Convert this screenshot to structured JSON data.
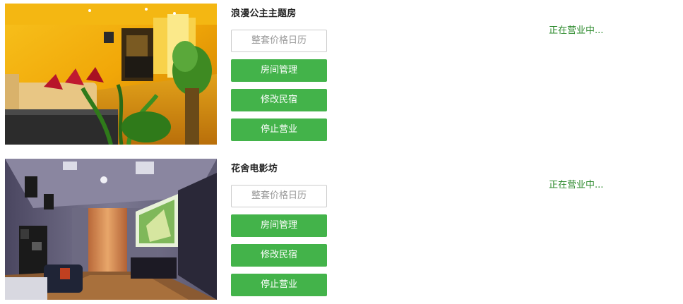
{
  "listings": [
    {
      "name": "浪漫公主主题房",
      "status": "正在营业中...",
      "buttons": {
        "calendar": "整套价格日历",
        "rooms": "房间管理",
        "edit": "修改民宿",
        "stop": "停止营业"
      },
      "photo_alt": "warm yellow lit living room with sofa and plants"
    },
    {
      "name": "花舍电影坊",
      "status": "正在营业中...",
      "buttons": {
        "calendar": "整套价格日历",
        "rooms": "房间管理",
        "edit": "修改民宿",
        "stop": "停止营业"
      },
      "photo_alt": "dim room with projector screen and curtains"
    }
  ],
  "colors": {
    "accent": "#43b34a",
    "status": "#2e8b2e",
    "outline_border": "#cccccc",
    "outline_text": "#999999"
  }
}
